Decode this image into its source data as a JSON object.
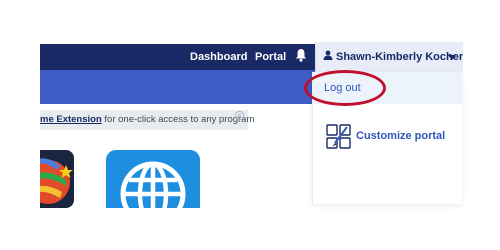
{
  "header": {
    "nav": [
      {
        "label": "Dashboard"
      },
      {
        "label": "Portal"
      }
    ],
    "bell_icon": "bell-icon",
    "user": {
      "name": "Shawn-Kimberly Kocher",
      "icon": "user-icon",
      "caret_icon": "caret-down-icon"
    }
  },
  "banner": {
    "link_text": "me Extension",
    "text": " for one-click access to any program",
    "close_icon": "close-icon"
  },
  "user_menu": {
    "items": [
      {
        "label": "Log out"
      },
      {
        "label": "Customize portal",
        "icon": "customize-portal-icon"
      }
    ]
  },
  "apps": [
    {
      "icon": "app-icon-colorful"
    },
    {
      "icon": "globe-icon"
    }
  ],
  "colors": {
    "navbar": "#1a2a66",
    "subbar": "#3f5cc6",
    "link": "#2f56b8",
    "highlight": "#c0102b",
    "globe_tile": "#1d8ee0"
  }
}
